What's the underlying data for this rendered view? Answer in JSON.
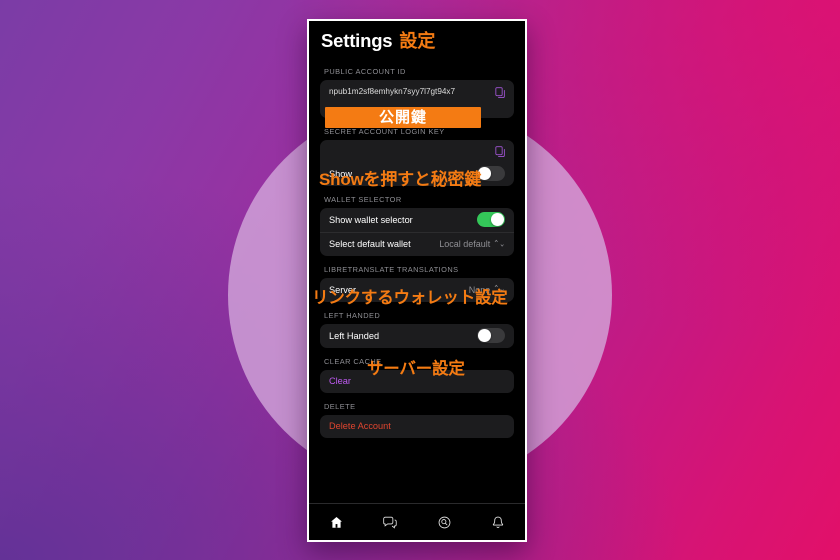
{
  "background": {
    "gradient_from": "#7b3ca6",
    "gradient_to": "#e21069",
    "circle_color": "#d5aadd"
  },
  "theme": {
    "accent_orange": "#f47b13",
    "screen_bg": "#000000",
    "card_bg": "#1c1c1e",
    "label_gray": "#8e8e93",
    "toggle_on": "#34c759",
    "toggle_off": "#3a3a3c",
    "clear_purple": "#bf5af2",
    "delete_red": "#e0452f",
    "copy_icon_purple": "#a255d6"
  },
  "header": {
    "title_en": "Settings",
    "title_jp": "設定"
  },
  "sections": {
    "public_account_id": {
      "label": "PUBLIC ACCOUNT ID",
      "value": "npub1m2sf8emhykn7syy7l7gt94x7",
      "copy_icon": "copy-icon"
    },
    "secret_login_key": {
      "label": "SECRET ACCOUNT LOGIN KEY",
      "value": "",
      "copy_icon": "copy-icon",
      "show_label": "Show",
      "show_state": "off"
    },
    "wallet_selector": {
      "label": "WALLET SELECTOR",
      "show_wallet_selector_label": "Show wallet selector",
      "show_wallet_selector_state": "on",
      "select_default_wallet_label": "Select default wallet",
      "select_default_wallet_value": "Local default",
      "chevron": "chevron-updown-icon"
    },
    "libretranslate": {
      "label": "LIBRETRANSLATE TRANSLATIONS",
      "server_label": "Server",
      "server_value": "None",
      "chevron": "chevron-updown-icon"
    },
    "left_handed": {
      "label": "LEFT HANDED",
      "row_label": "Left Handed",
      "state": "off"
    },
    "clear_cache": {
      "label": "CLEAR CACHE",
      "action_label": "Clear"
    },
    "delete": {
      "label": "DELETE",
      "action_label": "Delete Account"
    }
  },
  "annotations": [
    {
      "id": "pubkey",
      "text": "公開鍵"
    },
    {
      "id": "secret",
      "text": "Showを押すと秘密鍵"
    },
    {
      "id": "wallet",
      "text": "リンクするウォレット設定"
    },
    {
      "id": "server",
      "text": "サーバー設定"
    }
  ],
  "tabbar": {
    "items": [
      {
        "name": "home-icon",
        "active": true
      },
      {
        "name": "messages-icon",
        "active": false
      },
      {
        "name": "search-icon",
        "active": false
      },
      {
        "name": "notifications-bell-icon",
        "active": false
      }
    ]
  }
}
